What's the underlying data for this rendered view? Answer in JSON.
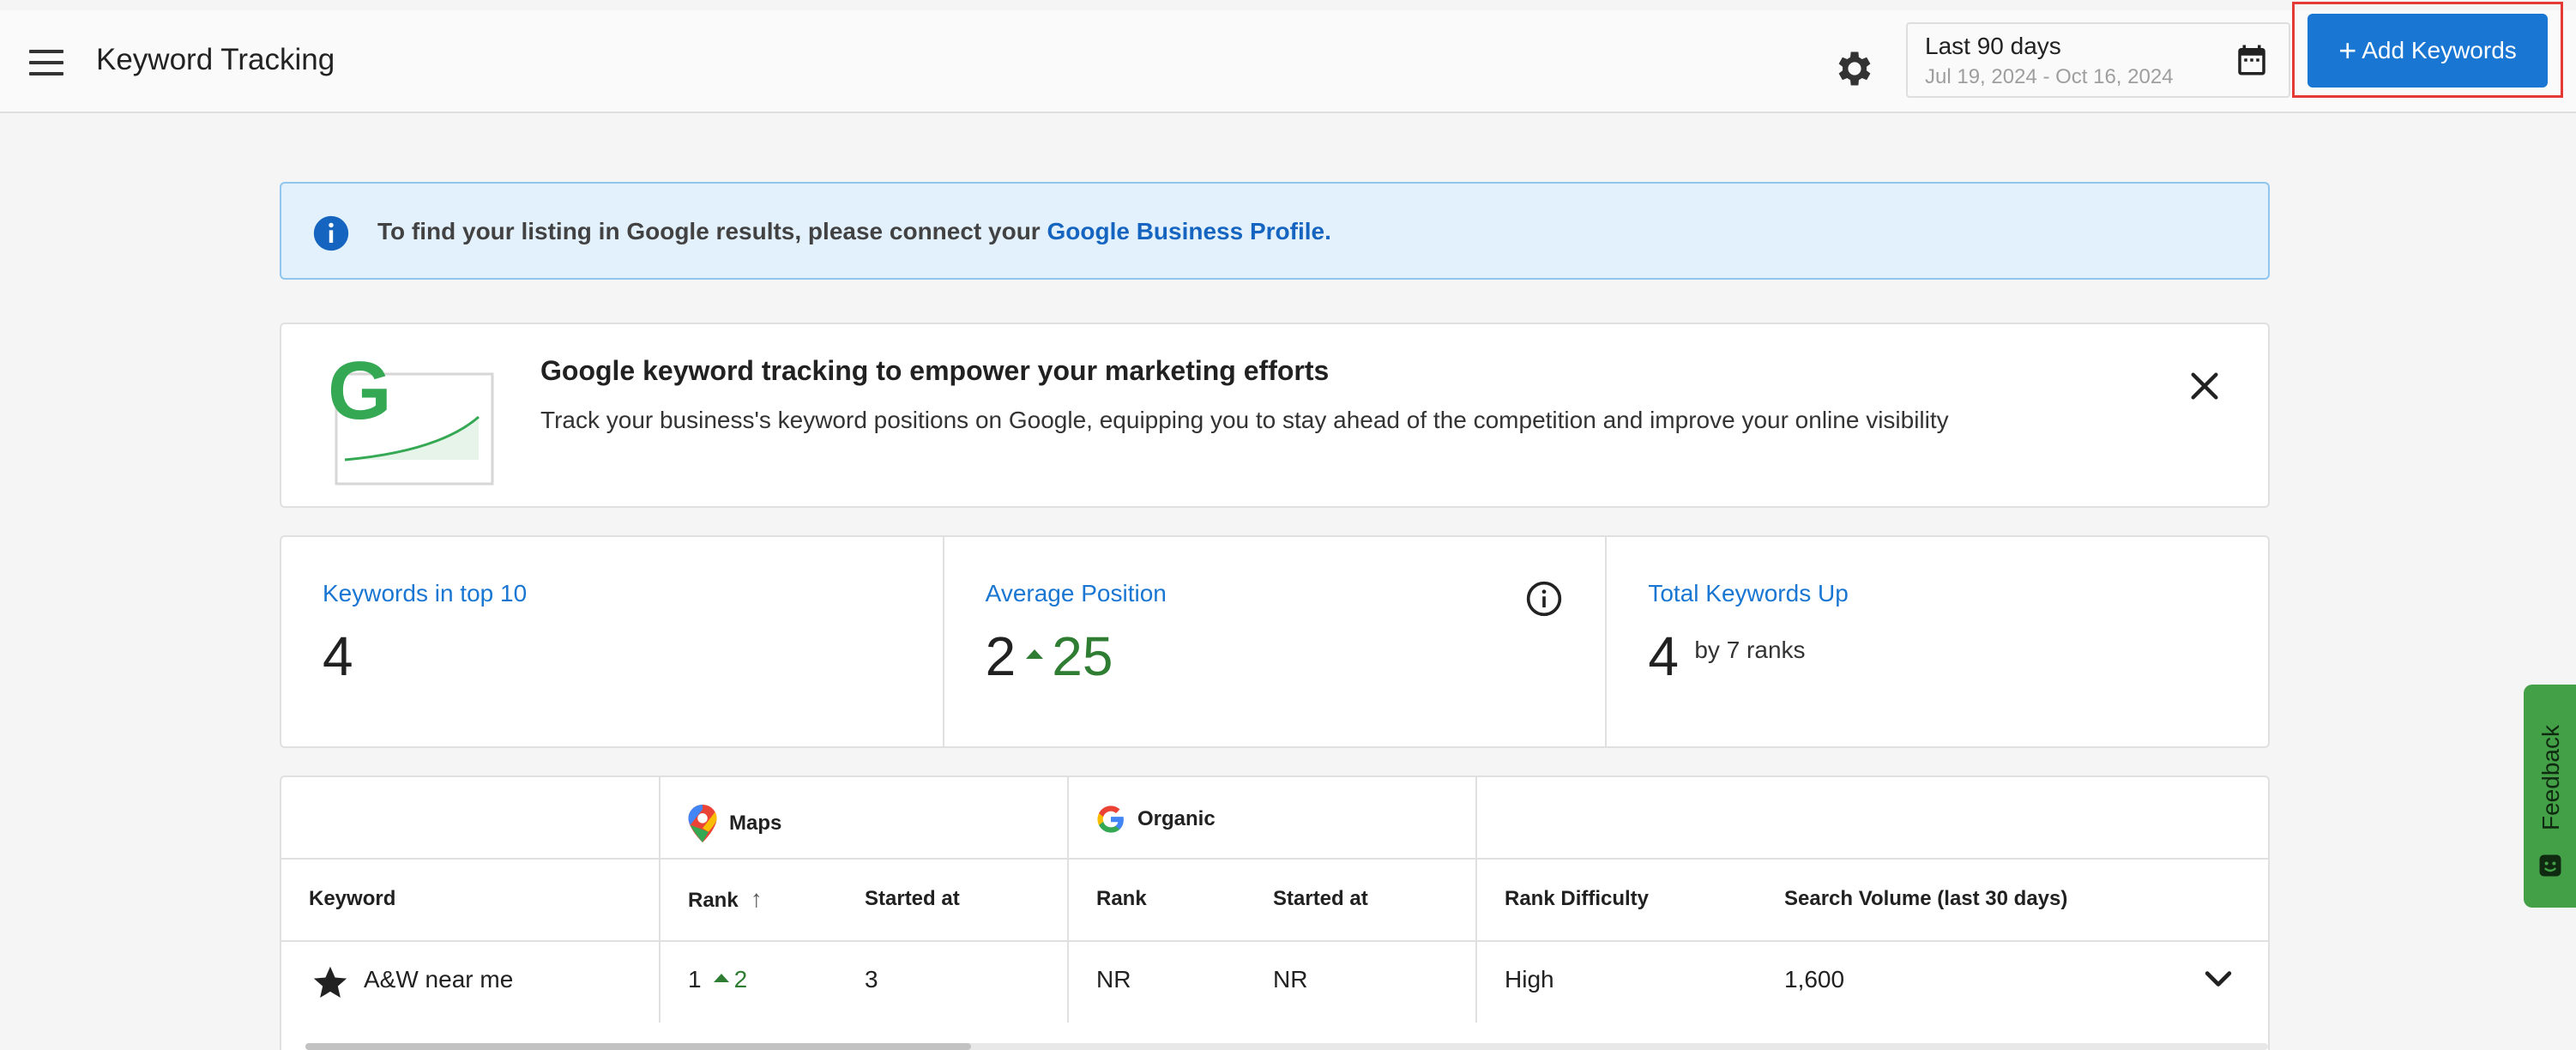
{
  "header": {
    "title": "Keyword Tracking",
    "date_range": {
      "label": "Last 90 days",
      "dates": "Jul 19, 2024 - Oct 16, 2024"
    },
    "add_button": "Add Keywords",
    "add_button_icon": "+",
    "colors": {
      "primary": "#1976d2",
      "highlight_outline": "#e53935"
    }
  },
  "alert": {
    "text": "To find your listing in Google results, please connect your ",
    "link": "Google Business Profile."
  },
  "promo": {
    "title": "Google keyword tracking to empower your marketing efforts",
    "text": "Track your business's keyword positions on Google, equipping you to stay ahead of the competition and improve your online visibility"
  },
  "stats": [
    {
      "label": "Keywords in top 10",
      "value": "4"
    },
    {
      "label": "Average Position",
      "value": "2",
      "change": "25"
    },
    {
      "label": "Total Keywords Up",
      "value": "4",
      "sub": "by 7 ranks"
    }
  ],
  "table": {
    "groups": {
      "maps": "Maps",
      "organic": "Organic"
    },
    "columns": {
      "keyword": "Keyword",
      "maps_rank": "Rank",
      "maps_started": "Started at",
      "organic_rank": "Rank",
      "organic_started": "Started at",
      "difficulty": "Rank Difficulty",
      "volume": "Search Volume (last 30 days)"
    },
    "rows": [
      {
        "keyword": "A&W near me",
        "maps_rank": "1",
        "maps_change": "2",
        "maps_started": "3",
        "organic_rank": "NR",
        "organic_started": "NR",
        "difficulty": "High",
        "volume": "1,600"
      }
    ]
  },
  "feedback": {
    "label": "Feedback",
    "color": "#43a047"
  }
}
